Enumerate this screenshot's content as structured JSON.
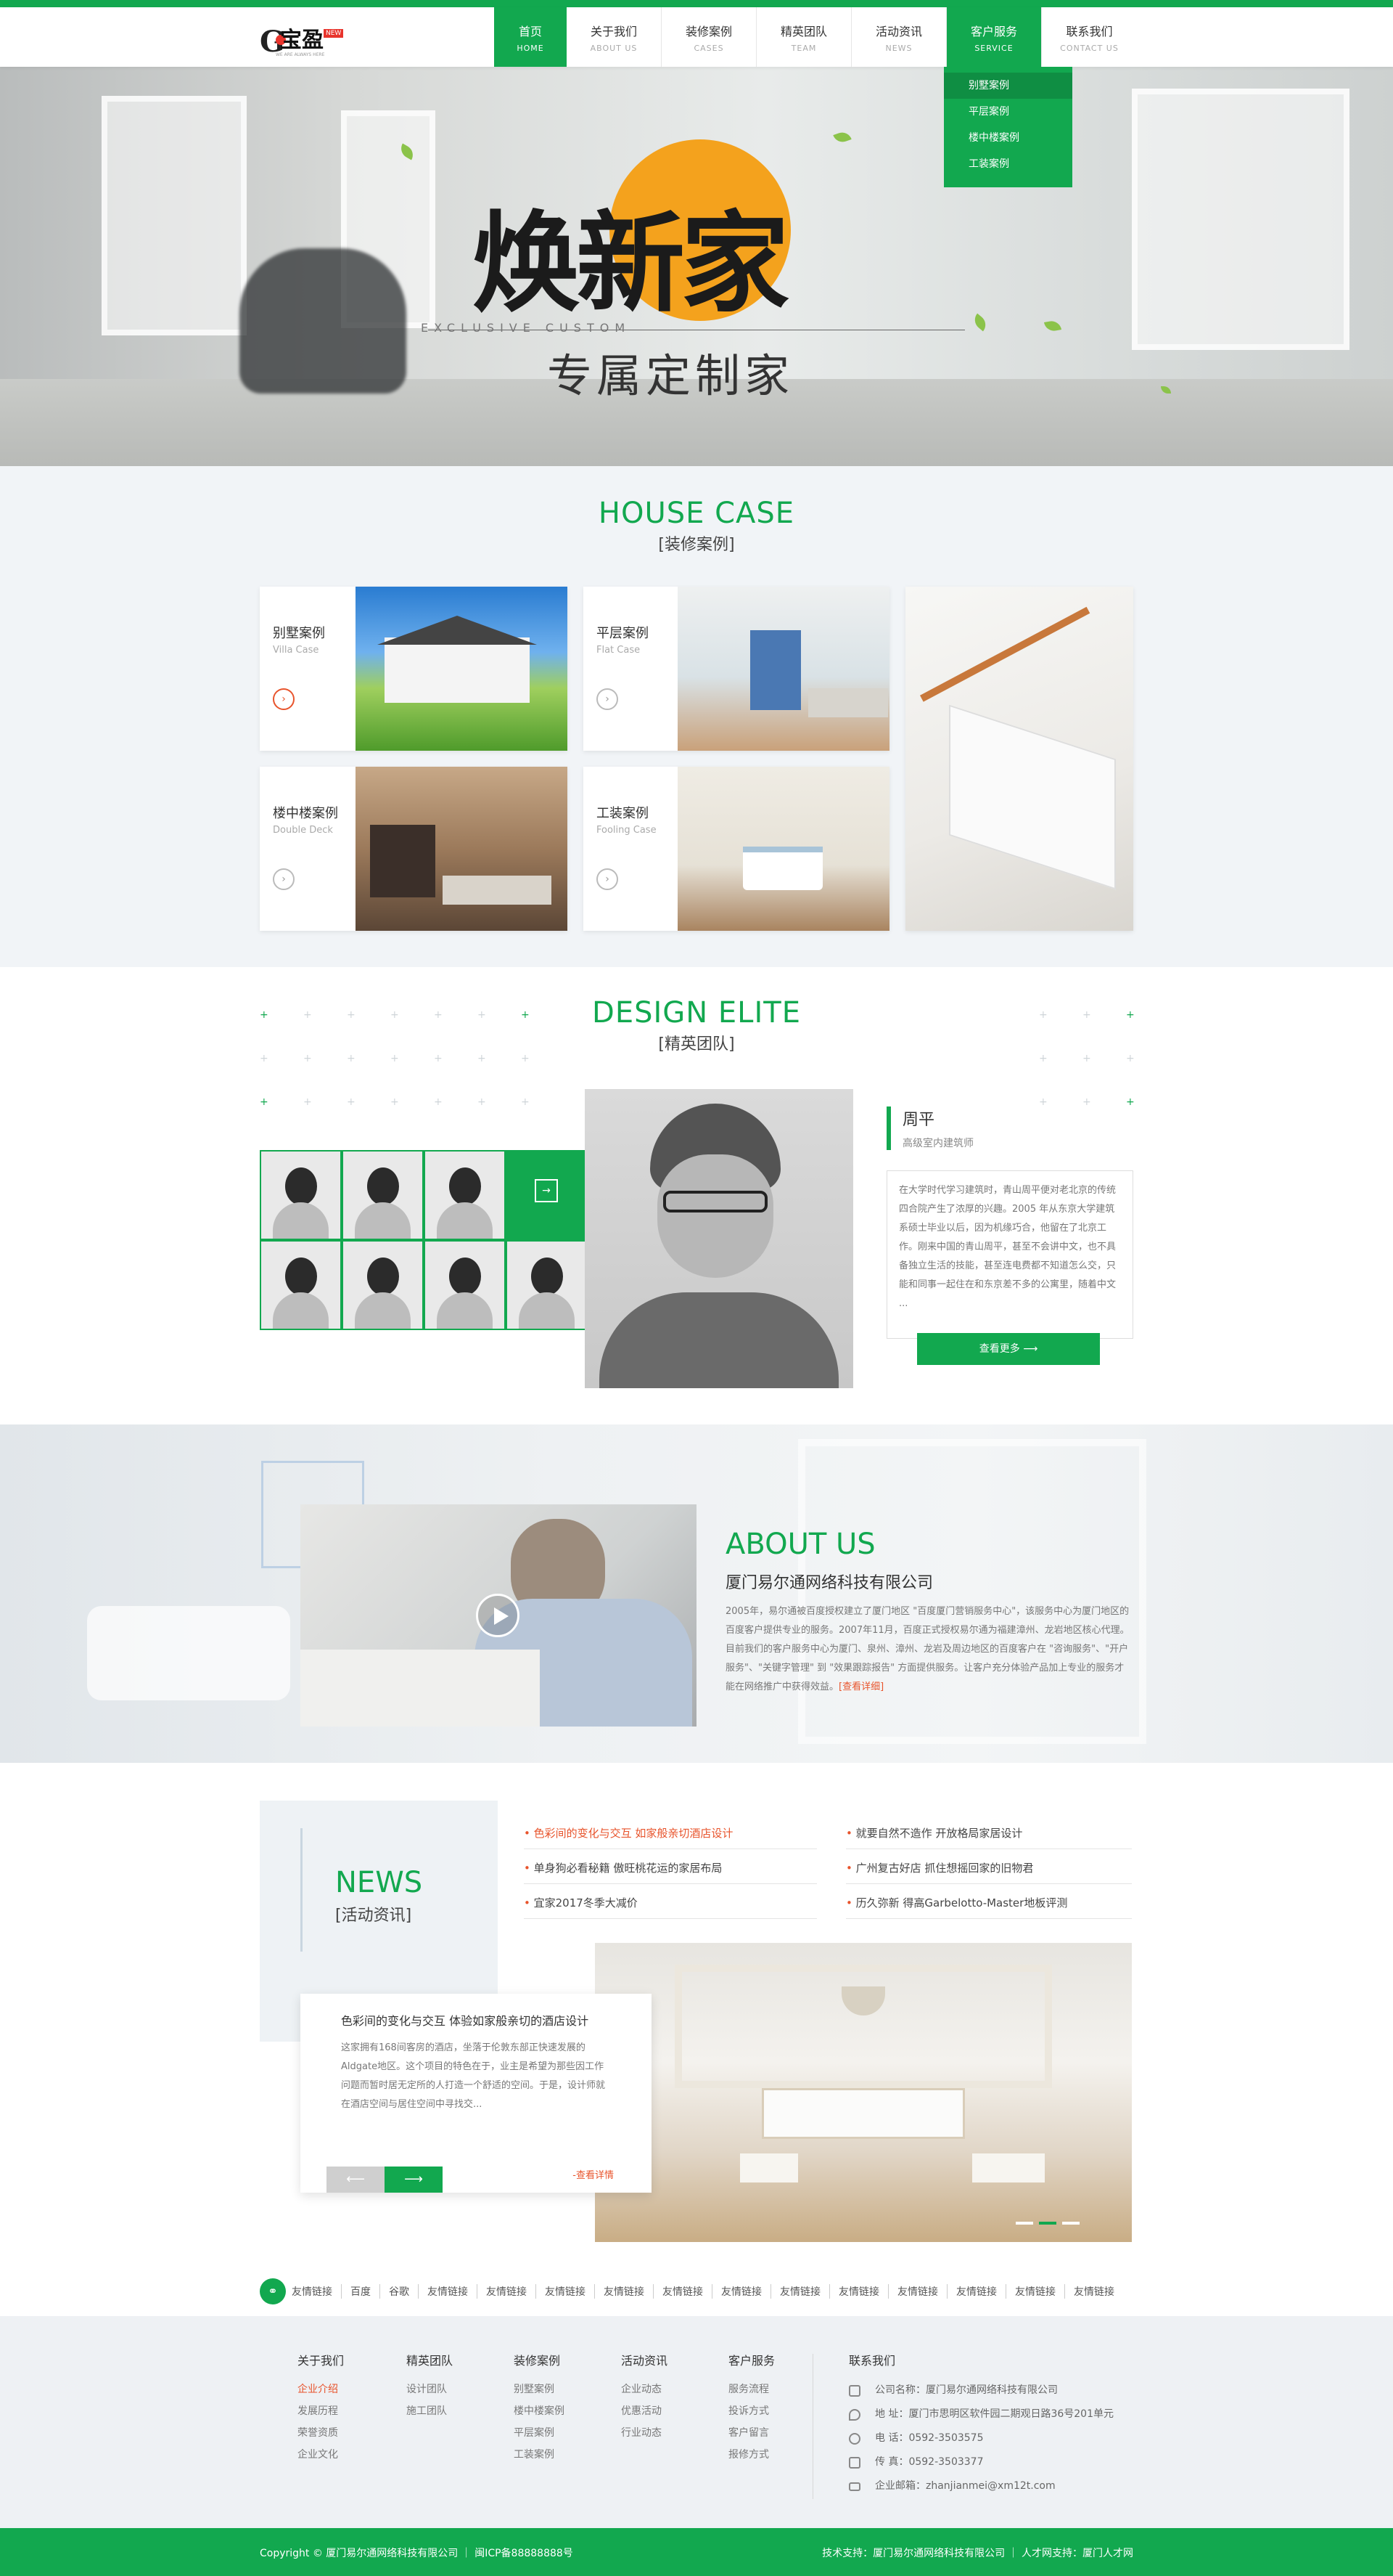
{
  "logo": {
    "letter": "G",
    "text": "宝盈",
    "badge": "NEW",
    "sub": "WE ARE ALWAYS HERE"
  },
  "nav": [
    {
      "cn": "首页",
      "en": "HOME"
    },
    {
      "cn": "关于我们",
      "en": "ABOUT US"
    },
    {
      "cn": "装修案例",
      "en": "CASES"
    },
    {
      "cn": "精英团队",
      "en": "TEAM"
    },
    {
      "cn": "活动资讯",
      "en": "NEWS"
    },
    {
      "cn": "客户服务",
      "en": "SERVICE"
    },
    {
      "cn": "联系我们",
      "en": "CONTACT US"
    }
  ],
  "dropdown": [
    "别墅案例",
    "平层案例",
    "楼中楼案例",
    "工装案例"
  ],
  "banner": {
    "big": "焕新家",
    "en": "EXCLUSIVE CUSTOM",
    "slogan": "专属定制家"
  },
  "house": {
    "en": "HOUSE CASE",
    "cn": "[装修案例]",
    "cards": [
      {
        "t": "别墅案例",
        "s": "Villa Case"
      },
      {
        "t": "平层案例",
        "s": "Flat Case"
      },
      {
        "t": "楼中楼案例",
        "s": "Double Deck"
      },
      {
        "t": "工装案例",
        "s": "Fooling Case"
      }
    ]
  },
  "elite": {
    "en": "DESIGN ELITE",
    "cn": "[精英团队]",
    "name": "周平",
    "role": "高级室内建筑师",
    "bio": "在大学时代学习建筑时，青山周平便对老北京的传统四合院产生了浓厚的兴趣。2005 年从东京大学建筑系硕士毕业以后，因为机缘巧合，他留在了北京工作。刚来中国的青山周平，甚至不会讲中文，也不具备独立生活的技能，甚至连电费都不知道怎么交，只能和同事一起住在和东京差不多的公寓里，随着中文 ...",
    "more": "查看更多"
  },
  "about": {
    "en": "ABOUT US",
    "company": "厦门易尔通网络科技有限公司",
    "text": "2005年，易尔通被百度授权建立了厦门地区 \"百度厦门营销服务中心\"，该服务中心为厦门地区的百度客户提供专业的服务。2007年11月，百度正式授权易尔通为福建漳州、龙岩地区核心代理。目前我们的客户服务中心为厦门、泉州、漳州、龙岩及周边地区的百度客户在 \"咨询服务\"、\"开户服务\"、\"关键字管理\" 到 \"效果跟踪报告\" 方面提供服务。让客户充分体验产品加上专业的服务才能在网络推广中获得效益。",
    "link": "[查看详细]"
  },
  "news": {
    "en": "NEWS",
    "cn": "[活动资讯]",
    "items": [
      "色彩间的变化与交互 如家般亲切酒店设计",
      "就要自然不造作 开放格局家居设计",
      "单身狗必看秘籍 傲旺桃花运的家居布局",
      "广州复古好店 抓住想摇回家的旧物君",
      "宜家2017冬季大减价",
      "历久弥新 得高Garbelotto-Master地板评测"
    ],
    "pop_title": "色彩间的变化与交互 体验如家般亲切的酒店设计",
    "pop_text": "这家拥有168间客房的酒店，坐落于伦敦东部正快速发展的Aldgate地区。这个项目的特色在于，业主是希望为那些因工作问题而暂时居无定所的人打造一个舒适的空间。于是，设计师就在酒店空间与居住空间中寻找交...",
    "pop_more": "-查看详情",
    "prev": "⟵",
    "next": "⟶"
  },
  "links": {
    "label": "友情链接",
    "items": [
      "百度",
      "谷歌",
      "友情链接",
      "友情链接",
      "友情链接",
      "友情链接",
      "友情链接",
      "友情链接",
      "友情链接",
      "友情链接",
      "友情链接",
      "友情链接",
      "友情链接",
      "友情链接"
    ]
  },
  "footer": {
    "cols": [
      {
        "h": "关于我们",
        "items": [
          "企业介绍",
          "发展历程",
          "荣誉资质",
          "企业文化"
        ]
      },
      {
        "h": "精英团队",
        "items": [
          "设计团队",
          "施工团队"
        ]
      },
      {
        "h": "装修案例",
        "items": [
          "别墅案例",
          "楼中楼案例",
          "平层案例",
          "工装案例"
        ]
      },
      {
        "h": "活动资讯",
        "items": [
          "企业动态",
          "优惠活动",
          "行业动态"
        ]
      },
      {
        "h": "客户服务",
        "items": [
          "服务流程",
          "投诉方式",
          "客户留言",
          "报修方式"
        ]
      }
    ],
    "contact": {
      "h": "联系我们",
      "rows": [
        "公司名称：厦门易尔通网络科技有限公司",
        "地      址：厦门市思明区软件园二期观日路36号201单元",
        "电      话：0592-3503575",
        "传      真：0592-3503377",
        "企业邮箱：zhanjianmei@xm12t.com"
      ]
    },
    "copyright": "Copyright © 厦门易尔通网络科技有限公司 ｜ 闽ICP备88888888号",
    "support": "技术支持：厦门易尔通网络科技有限公司 ｜ 人才网支持：厦门人才网"
  }
}
